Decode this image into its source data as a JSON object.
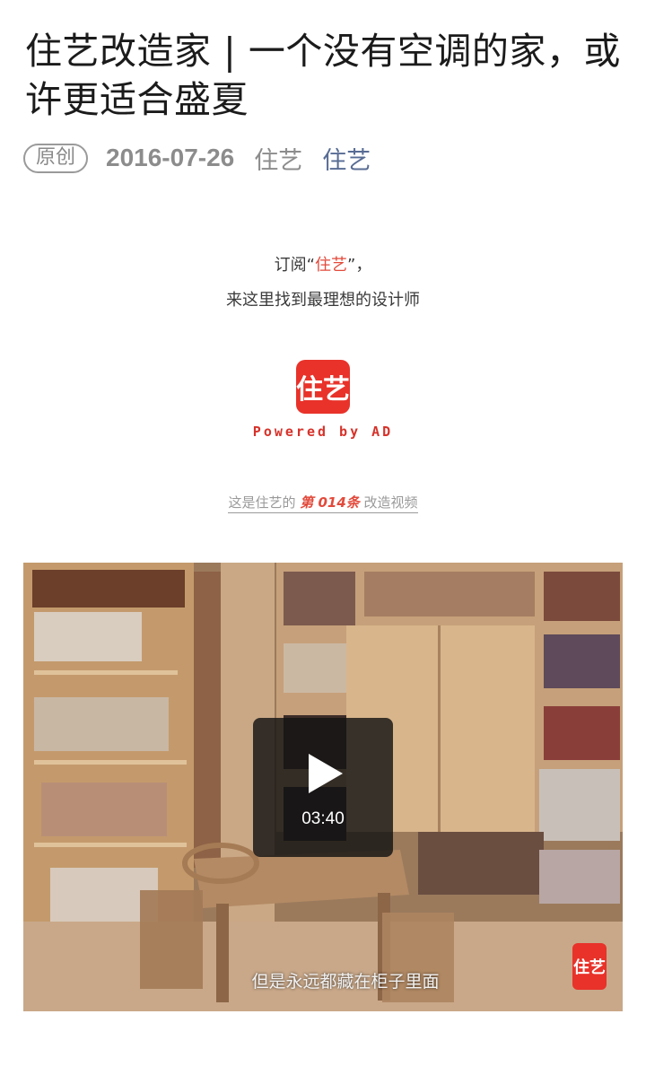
{
  "article": {
    "title": "住艺改造家 | 一个没有空调的家，或许更适合盛夏",
    "badge": "原创",
    "date": "2016-07-26",
    "author": "住艺",
    "account": "住艺"
  },
  "intro": {
    "line1_prefix": "订阅“",
    "line1_highlight": "住艺",
    "line1_suffix": "”，",
    "line2": "来这里找到最理想的设计师"
  },
  "brand": {
    "logo_text": "住艺",
    "powered_by": "Powered by AD",
    "accent_color": "#e8322a"
  },
  "episode": {
    "prefix": "这是住艺的 ",
    "number": "第 014条",
    "suffix": " 改造视频"
  },
  "video": {
    "duration": "03:40",
    "subtitle": "但是永远都藏在柜子里面",
    "watermark_text": "住艺",
    "play_icon": "play-icon"
  }
}
